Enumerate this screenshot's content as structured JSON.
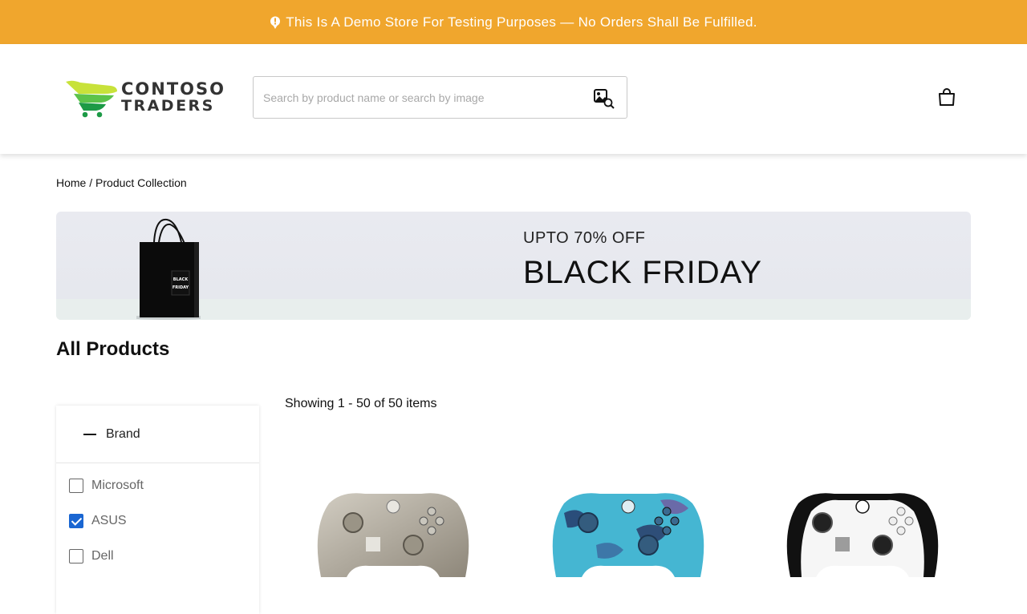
{
  "announcement": {
    "text": "This Is A Demo Store For Testing Purposes — No Orders Shall Be Fulfilled.",
    "icon": "pin-icon",
    "bg_color": "#f0a62d"
  },
  "header": {
    "logo": {
      "line1": "CONTOSO",
      "line2": "TRADERS"
    },
    "search": {
      "placeholder": "Search by product name or search by image",
      "value": "",
      "icon": "image-search-icon"
    },
    "cart_icon": "shopping-bag-icon"
  },
  "breadcrumb": {
    "home": "Home",
    "separator": " / ",
    "current": "Product Collection"
  },
  "banner": {
    "subtitle": "UPTO 70% OFF",
    "title": "BLACK FRIDAY",
    "bag_text": "BLACK FRIDAY"
  },
  "page_title": "All Products",
  "filters": {
    "brand": {
      "label": "Brand",
      "expanded": true,
      "options": [
        {
          "label": "Microsoft",
          "checked": false
        },
        {
          "label": "ASUS",
          "checked": true
        },
        {
          "label": "Dell",
          "checked": false
        }
      ]
    }
  },
  "results_summary": "Showing 1 - 50 of 50 items",
  "products": [
    {
      "name": "controller-lunar-shift",
      "color": "#b7b0a2"
    },
    {
      "name": "controller-blue-camo",
      "color": "#3aa7c4"
    },
    {
      "name": "controller-elite-white",
      "color": "#f4f4f4"
    }
  ],
  "colors": {
    "accent": "#1a66d2"
  }
}
